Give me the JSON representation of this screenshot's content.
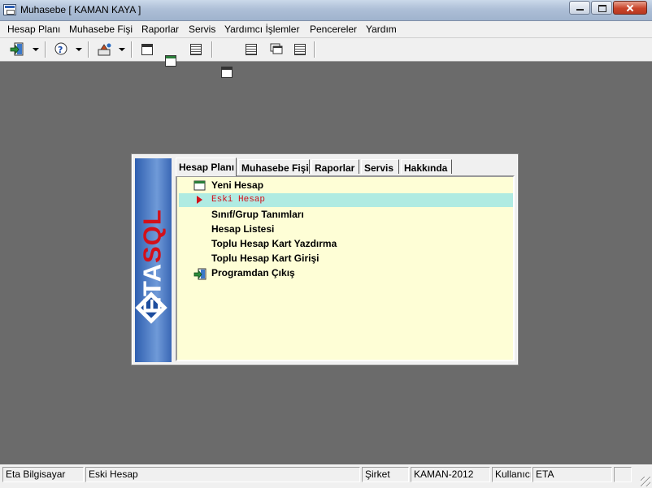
{
  "window": {
    "title": "Muhasebe [ KAMAN KAYA ]"
  },
  "menubar": {
    "items": [
      {
        "label": "Hesap Planı"
      },
      {
        "label": "Muhasebe Fişi"
      },
      {
        "label": "Raporlar"
      },
      {
        "label": "Servis"
      },
      {
        "label": "Yardımcı İşlemler"
      },
      {
        "label": "Pencereler"
      },
      {
        "label": "Yardım"
      }
    ]
  },
  "toolbar": {
    "icons": [
      "exit-icon",
      "help-icon",
      "tool-icon",
      "window-icon",
      "window-icon",
      "window-list-icon",
      "print-icon",
      "print-list-icon",
      "cascade-icon",
      "grid-icon"
    ]
  },
  "dialog": {
    "brand": {
      "left": "ETA",
      "right": "SQL"
    },
    "tabs": [
      {
        "label": "Hesap Planı",
        "active": true
      },
      {
        "label": "Muhasebe Fişi"
      },
      {
        "label": "Raporlar"
      },
      {
        "label": "Servis"
      },
      {
        "label": "Hakkında"
      }
    ],
    "items": [
      {
        "label": "Yeni Hesap",
        "icon": "new-window-icon"
      },
      {
        "label": "Eski Hesap",
        "icon": "arrow-right-icon",
        "selected": true
      },
      {
        "label": "Sınıf/Grup Tanımları"
      },
      {
        "label": "Hesap Listesi"
      },
      {
        "label": "Toplu Hesap Kart Yazdırma"
      },
      {
        "label": "Toplu Hesap Kart Girişi"
      },
      {
        "label": "Programdan Çıkış",
        "icon": "exit-icon"
      }
    ]
  },
  "statusbar": {
    "computer": "Eta Bilgisayar",
    "current_item": "Eski Hesap",
    "company_label": "Şirket",
    "company_value": "KAMAN-2012",
    "user_label": "Kullanıcı",
    "user_value": "ETA"
  },
  "colors": {
    "desktop": "#6b6b6b",
    "panel_bg": "#fefed6",
    "selection": "#b0ebe2",
    "selected_text": "#d3101a"
  }
}
